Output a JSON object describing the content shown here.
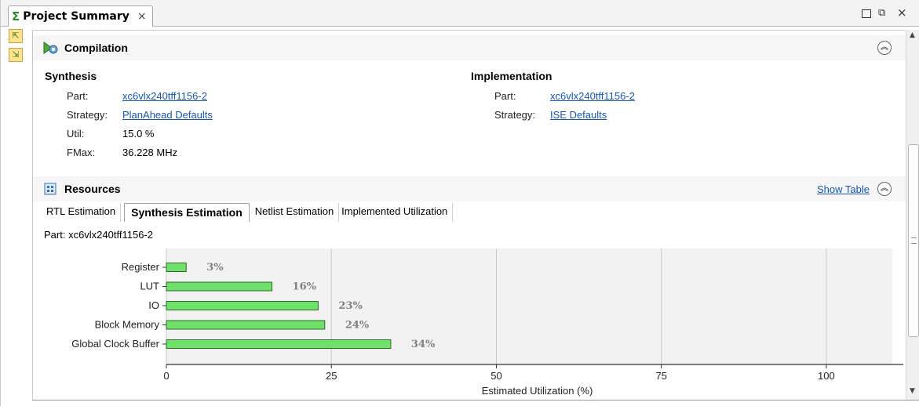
{
  "tab": {
    "title": "Project Summary",
    "close": "×"
  },
  "window_controls": {
    "restore": "⧉",
    "close": "×"
  },
  "compilation": {
    "title": "Compilation",
    "synthesis": {
      "heading": "Synthesis",
      "part_label": "Part:",
      "part_value": "xc6vlx240tff1156-2",
      "strategy_label": "Strategy:",
      "strategy_value": "PlanAhead Defaults",
      "util_label": "Util:",
      "util_value": "15.0 %",
      "fmax_label": "FMax:",
      "fmax_value": "36.228 MHz"
    },
    "implementation": {
      "heading": "Implementation",
      "part_label": "Part:",
      "part_value": "xc6vlx240tff1156-2",
      "strategy_label": "Strategy:",
      "strategy_value": "ISE Defaults"
    }
  },
  "resources": {
    "title": "Resources",
    "show_table": "Show Table",
    "tabs": [
      {
        "label": "RTL Estimation"
      },
      {
        "label": "Synthesis Estimation"
      },
      {
        "label": "Netlist Estimation"
      },
      {
        "label": "Implemented Utilization"
      }
    ],
    "part_line": "Part:  xc6vlx240tff1156-2"
  },
  "chart_data": {
    "type": "bar",
    "orientation": "horizontal",
    "categories": [
      "Register",
      "LUT",
      "IO",
      "Block Memory",
      "Global Clock Buffer"
    ],
    "values": [
      3,
      16,
      23,
      24,
      34
    ],
    "value_labels": [
      "3%",
      "16%",
      "23%",
      "24%",
      "34%"
    ],
    "xlabel": "Estimated Utilization (%)",
    "xticks": [
      "0",
      "25",
      "50",
      "75",
      "100"
    ],
    "xlim": [
      0,
      110
    ],
    "grid": true,
    "bar_color": "#6fe06a",
    "bar_border": "#2a6a2a",
    "label_color": "#808080"
  },
  "colors": {
    "link": "#1557b5",
    "accent_green": "#2f8b2a",
    "section_bg": "#f6f6f6"
  }
}
